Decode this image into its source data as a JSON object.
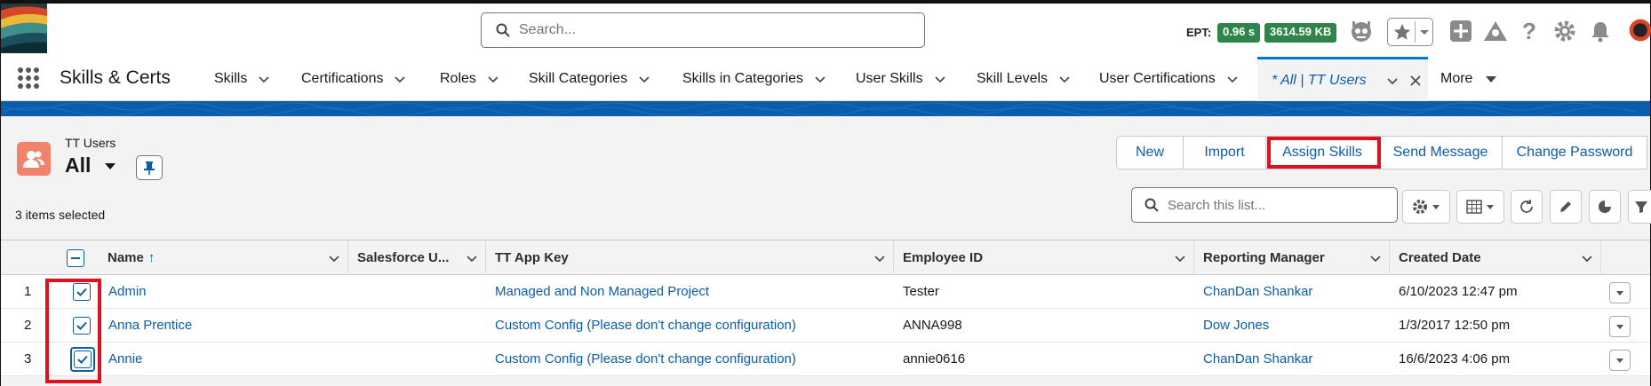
{
  "header": {
    "search_placeholder": "Search...",
    "ept_label": "EPT:",
    "ept_time": "0.96 s",
    "ept_size": "3614.59 KB",
    "icons": [
      "robot-icon",
      "star-icon",
      "add-icon",
      "trailhead-icon",
      "help-icon",
      "settings-icon",
      "bell-icon"
    ]
  },
  "nav": {
    "app_name": "Skills & Certs",
    "tabs": [
      {
        "label": "Skills"
      },
      {
        "label": "Certifications"
      },
      {
        "label": "Roles"
      },
      {
        "label": "Skill Categories"
      },
      {
        "label": "Skills in Categories"
      },
      {
        "label": "User Skills"
      },
      {
        "label": "Skill Levels"
      },
      {
        "label": "User Certifications"
      }
    ],
    "active_tab": "* All | TT Users",
    "more_label": "More"
  },
  "list": {
    "object_label": "TT Users",
    "view_name": "All",
    "actions": {
      "new": "New",
      "import": "Import",
      "assign_skills": "Assign Skills",
      "send_message": "Send Message",
      "change_password": "Change Password"
    },
    "selected_count": "3 items selected",
    "search_placeholder": "Search this list...",
    "columns": {
      "name": "Name",
      "sort_arrow": "↑",
      "salesforce_user": "Salesforce U...",
      "tt_app_key": "TT App Key",
      "employee_id": "Employee ID",
      "reporting_manager": "Reporting Manager",
      "created_date": "Created Date"
    },
    "rows": [
      {
        "num": "1",
        "name": "Admin",
        "app_key": "Managed and Non Managed Project",
        "employee_id": "Tester",
        "manager": "ChanDan Shankar",
        "created": "6/10/2023 12:47 pm"
      },
      {
        "num": "2",
        "name": "Anna Prentice",
        "app_key": "Custom Config (Please don't change configuration)",
        "employee_id": "ANNA998",
        "manager": "Dow Jones",
        "created": "1/3/2017 12:50 pm"
      },
      {
        "num": "3",
        "name": "Annie",
        "app_key": "Custom Config (Please don't change configuration)",
        "employee_id": "annie0616",
        "manager": "ChanDan Shankar",
        "created": "16/6/2023 4:06 pm"
      }
    ]
  },
  "colors": {
    "brand_blue": "#0b5cab",
    "highlight_red": "#e0101f",
    "ept_green": "#2e844a",
    "object_icon": "#f2836b"
  }
}
